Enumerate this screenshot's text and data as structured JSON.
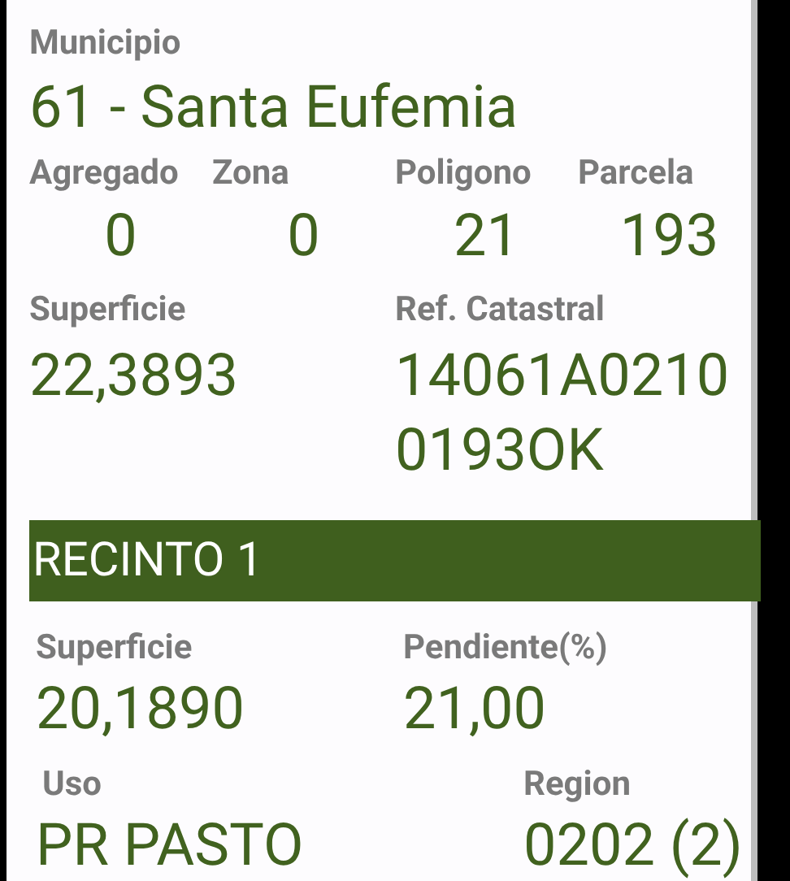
{
  "parcela": {
    "municipio": {
      "label": "Municipio",
      "value": "61 - Santa Eufemia"
    },
    "codes": [
      {
        "label": "Agregado",
        "value": "0"
      },
      {
        "label": "Zona",
        "value": "0"
      },
      {
        "label": "Poligono",
        "value": "21"
      },
      {
        "label": "Parcela",
        "value": "193"
      }
    ],
    "superficie": {
      "label": "Superficie",
      "value": "22,3893"
    },
    "ref_catastral": {
      "label": "Ref. Catastral",
      "value": "14061A02100193OK"
    }
  },
  "recinto": {
    "title": "RECINTO 1",
    "superficie": {
      "label": "Superficie",
      "value": "20,1890"
    },
    "pendiente": {
      "label": "Pendiente(%)",
      "value": "21,00"
    },
    "uso": {
      "label": "Uso",
      "value": "PR PASTO"
    },
    "region": {
      "label": "Region",
      "value": "0202 (2)"
    }
  }
}
